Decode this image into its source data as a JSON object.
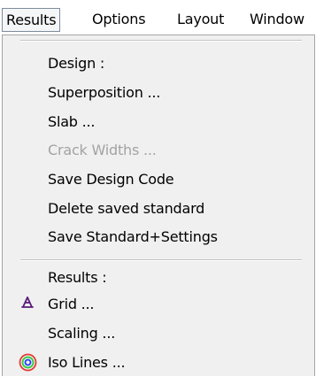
{
  "menubar": {
    "items": [
      {
        "label": "Results"
      },
      {
        "label": "Options"
      },
      {
        "label": "Layout"
      },
      {
        "label": "Window"
      }
    ]
  },
  "dropdown": {
    "items": [
      {
        "label": "Design :",
        "enabled": true
      },
      {
        "label": "Superposition ...",
        "enabled": true
      },
      {
        "label": "Slab ...",
        "enabled": true
      },
      {
        "label": "Crack Widths ...",
        "enabled": false
      },
      {
        "label": "Save Design Code",
        "enabled": true
      },
      {
        "label": "Delete saved standard",
        "enabled": true
      },
      {
        "label": "Save Standard+Settings",
        "enabled": true
      },
      {
        "label": "Results :",
        "enabled": true
      },
      {
        "label": "Grid ...",
        "enabled": true,
        "icon": "grid-triangle-icon"
      },
      {
        "label": "Scaling ...",
        "enabled": true
      },
      {
        "label": "Iso Lines ...",
        "enabled": true,
        "icon": "iso-lines-icon"
      }
    ]
  },
  "colors": {
    "menu_background": "#f0f0f0",
    "disabled_text": "#a3a3a3",
    "grid_icon": "#5a1a7a",
    "iso_outer": "#e53935",
    "iso_middle": "#2ecc40",
    "iso_inner": "#1e3cff"
  }
}
